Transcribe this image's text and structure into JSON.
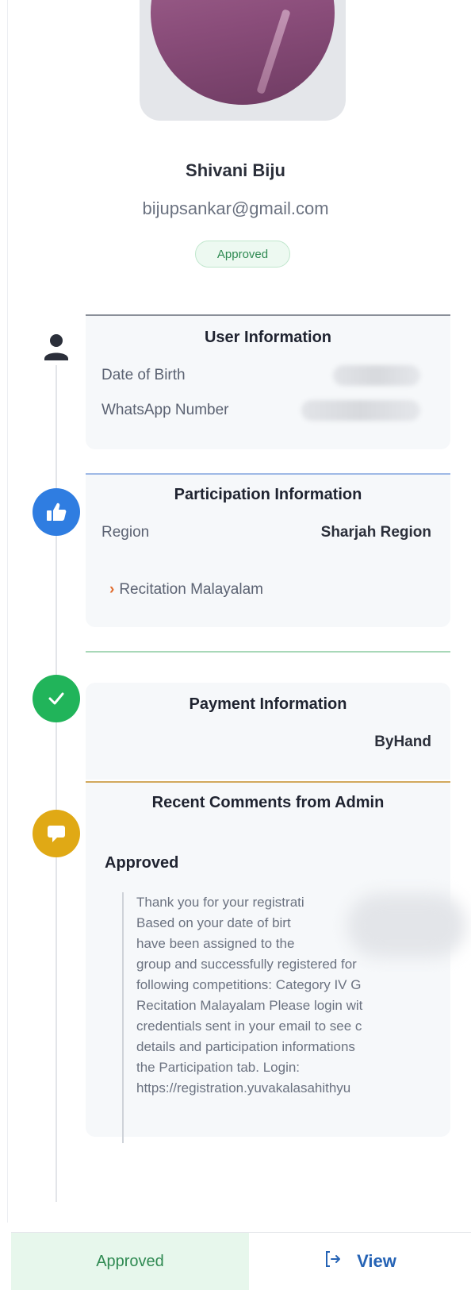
{
  "profile": {
    "name": "Shivani Biju",
    "email": "bijupsankar@gmail.com",
    "status_badge": "Approved"
  },
  "user_information": {
    "title": "User Information",
    "fields": [
      {
        "label": "Date of Birth",
        "value": ""
      },
      {
        "label": "WhatsApp Number",
        "value": ""
      }
    ]
  },
  "participation_information": {
    "title": "Participation Information",
    "region_label": "Region",
    "region_value": "Sharjah Region",
    "competitions": [
      "Recitation Malayalam"
    ]
  },
  "payment_information": {
    "title": "Payment Information",
    "method": "ByHand"
  },
  "comments": {
    "title": "Recent Comments from Admin",
    "status": "Approved",
    "text": "Thank you for your registrati\nBased on your date of birt\nhave been assigned to the\ngroup and successfully registered for\nfollowing competitions: Category IV G\nRecitation Malayalam Please login wit\ncredentials sent in your email to see c\ndetails and participation informations\nthe Participation tab. Login:\nhttps://registration.yuvakalasahithyu"
  },
  "footer": {
    "approved_label": "Approved",
    "view_label": "View"
  },
  "colors": {
    "user": "#2b2f3a",
    "participation": "#2f7de1",
    "payment": "#21b45a",
    "comments": "#e0a915"
  }
}
